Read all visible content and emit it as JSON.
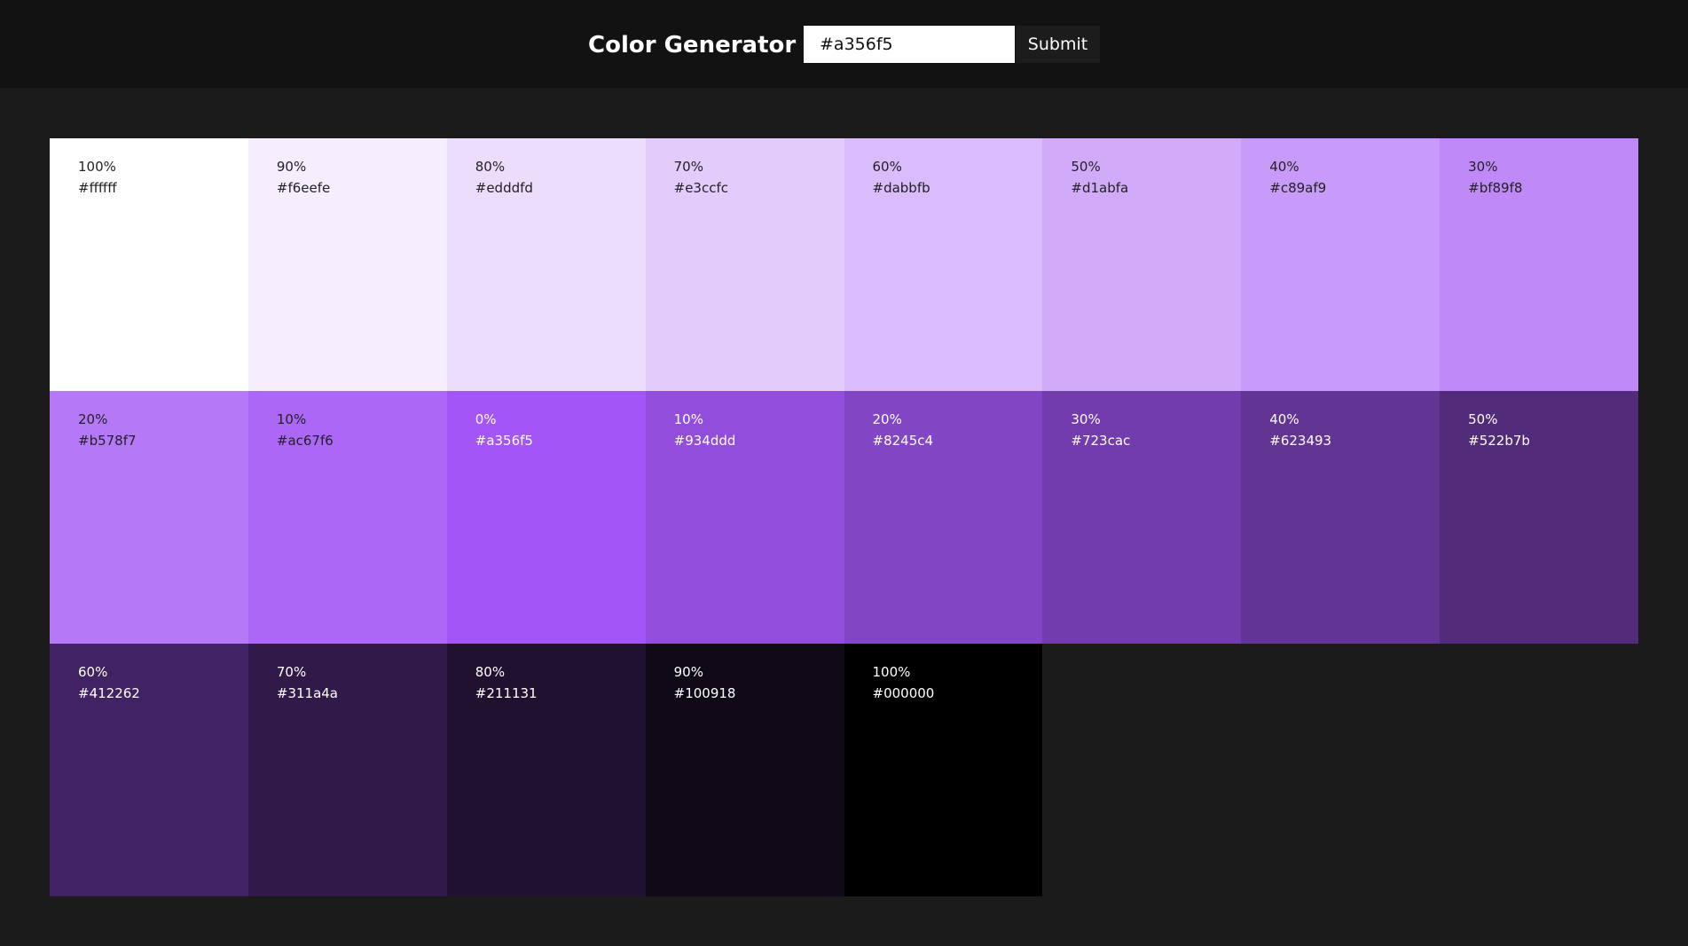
{
  "header": {
    "title": "Color Generator",
    "input_value": "#a356f5",
    "submit_label": "Submit"
  },
  "swatches": [
    {
      "percent": "100%",
      "hex": "#ffffff",
      "color": "#ffffff",
      "text_color": "#222222"
    },
    {
      "percent": "90%",
      "hex": "#f6eefe",
      "color": "#f6eefe",
      "text_color": "#222222"
    },
    {
      "percent": "80%",
      "hex": "#edddfd",
      "color": "#edddfd",
      "text_color": "#222222"
    },
    {
      "percent": "70%",
      "hex": "#e3ccfc",
      "color": "#e3ccfc",
      "text_color": "#222222"
    },
    {
      "percent": "60%",
      "hex": "#dabbfb",
      "color": "#dabbfb",
      "text_color": "#222222"
    },
    {
      "percent": "50%",
      "hex": "#d1abfa",
      "color": "#d1abfa",
      "text_color": "#222222"
    },
    {
      "percent": "40%",
      "hex": "#c89af9",
      "color": "#c89af9",
      "text_color": "#222222"
    },
    {
      "percent": "30%",
      "hex": "#bf89f8",
      "color": "#bf89f8",
      "text_color": "#222222"
    },
    {
      "percent": "20%",
      "hex": "#b578f7",
      "color": "#b578f7",
      "text_color": "#222222"
    },
    {
      "percent": "10%",
      "hex": "#ac67f6",
      "color": "#ac67f6",
      "text_color": "#222222"
    },
    {
      "percent": "0%",
      "hex": "#a356f5",
      "color": "#a356f5",
      "text_color": "#ffffff"
    },
    {
      "percent": "10%",
      "hex": "#934ddd",
      "color": "#934ddd",
      "text_color": "#ffffff"
    },
    {
      "percent": "20%",
      "hex": "#8245c4",
      "color": "#8245c4",
      "text_color": "#ffffff"
    },
    {
      "percent": "30%",
      "hex": "#723cac",
      "color": "#723cac",
      "text_color": "#ffffff"
    },
    {
      "percent": "40%",
      "hex": "#623493",
      "color": "#623493",
      "text_color": "#ffffff"
    },
    {
      "percent": "50%",
      "hex": "#522b7b",
      "color": "#522b7b",
      "text_color": "#ffffff"
    },
    {
      "percent": "60%",
      "hex": "#412262",
      "color": "#412262",
      "text_color": "#ffffff"
    },
    {
      "percent": "70%",
      "hex": "#311a4a",
      "color": "#311a4a",
      "text_color": "#ffffff"
    },
    {
      "percent": "80%",
      "hex": "#211131",
      "color": "#211131",
      "text_color": "#ffffff"
    },
    {
      "percent": "90%",
      "hex": "#100918",
      "color": "#100918",
      "text_color": "#ffffff"
    },
    {
      "percent": "100%",
      "hex": "#000000",
      "color": "#000000",
      "text_color": "#ffffff"
    }
  ]
}
